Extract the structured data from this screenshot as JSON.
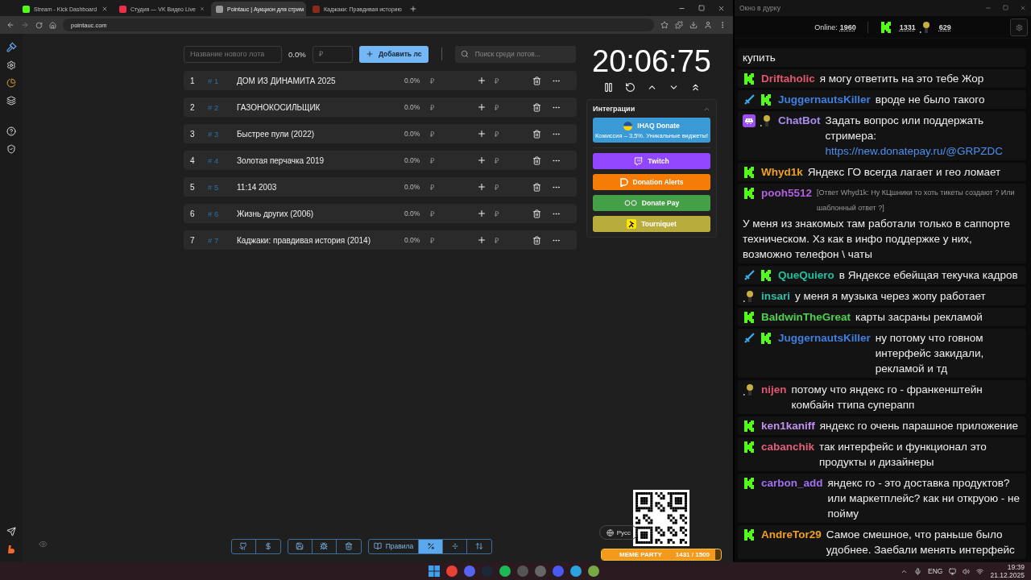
{
  "browser": {
    "tabs": [
      {
        "title": "Stream - Kick Dashboard",
        "kind": "kick",
        "selected": false
      },
      {
        "title": "Студия — VK Видео Live",
        "kind": "vk",
        "selected": false
      },
      {
        "title": "Pointauc | Аукцион для стрим",
        "kind": "pointauc",
        "selected": true
      },
      {
        "title": "Каджаки: Правдивая историю",
        "kind": "film",
        "selected": false
      }
    ],
    "address": "pointauc.com"
  },
  "auction": {
    "new_lot": {
      "name_placeholder": "Название нового лота",
      "percent": "0.0%",
      "amount_placeholder": "₽",
      "add_button": "Добавить лс"
    },
    "search": {
      "placeholder": "Поиск среди лотов..."
    },
    "lots": [
      {
        "index": "1",
        "id": "# 1",
        "name": "ДОМ ИЗ ДИНАМИТА 2025",
        "percent": "0.0%",
        "currency": "₽",
        "amount_placeholder": "₽"
      },
      {
        "index": "2",
        "id": "# 2",
        "name": "ГАЗОНОКОСИЛЬЩИК",
        "percent": "0.0%",
        "currency": "₽",
        "amount_placeholder": "₽"
      },
      {
        "index": "3",
        "id": "# 3",
        "name": "Быстрее пули (2022)",
        "percent": "0.0%",
        "currency": "₽",
        "amount_placeholder": "₽"
      },
      {
        "index": "4",
        "id": "# 4",
        "name": "Золотая перчачка 2019",
        "percent": "0.0%",
        "currency": "₽",
        "amount_placeholder": "₽"
      },
      {
        "index": "5",
        "id": "# 5",
        "name": "11:14 2003",
        "percent": "0.0%",
        "currency": "₽",
        "amount_placeholder": "₽"
      },
      {
        "index": "6",
        "id": "# 6",
        "name": "Жизнь других (2006)",
        "percent": "0.0%",
        "currency": "₽",
        "amount_placeholder": "₽"
      },
      {
        "index": "7",
        "id": "# 7",
        "name": "Каджаки: правдивая история (2014)",
        "percent": "0.0%",
        "currency": "₽",
        "amount_placeholder": "₽"
      }
    ],
    "timer": "20:06:75",
    "integrations": {
      "title": "Интеграции",
      "expanded": true,
      "services": [
        {
          "kind": "ihaq",
          "label": "IHAQ Donate",
          "subtitle": "Комиссия – 3,5%. Уникальные виджеты!"
        },
        {
          "kind": "twitch",
          "label": "Twitch"
        },
        {
          "kind": "donationalerts",
          "label": "Donation Alerts"
        },
        {
          "kind": "donatepay",
          "label": "Donate Pay"
        },
        {
          "kind": "tourniquet",
          "label": "Tourniquet"
        }
      ]
    },
    "toolbar": [
      {
        "kind": "github",
        "selected": false
      },
      {
        "kind": "dollar",
        "selected": false
      },
      {
        "kind": "save",
        "selected": false
      },
      {
        "kind": "bug",
        "selected": false
      },
      {
        "kind": "trash",
        "selected": false
      },
      {
        "kind": "rules",
        "label": "Правила",
        "selected": false
      },
      {
        "kind": "percent",
        "selected": true
      },
      {
        "kind": "divide",
        "selected": false
      },
      {
        "kind": "sort",
        "selected": false
      }
    ],
    "language": "Русс"
  },
  "overlay": {
    "party_title": "MEME PARTY",
    "party_progress": "1431 / 1500",
    "level": 0.95
  },
  "chat": {
    "window_title": "Окно в дурку",
    "online_label": "Online:",
    "online": "1960",
    "kick_count": "1331",
    "other_count": "629",
    "messages": [
      {
        "text": "купить"
      },
      {
        "badges": [
          {
            "kind": "kick"
          }
        ],
        "user": "Driftaholic",
        "color": "#e0566e",
        "text": "я могу ответить на это тебе Жор"
      },
      {
        "badges": [
          {
            "kind": "sword"
          },
          {
            "kind": "kick"
          }
        ],
        "user": "JuggernautsKiller",
        "color": "#3f7fe0",
        "text": "вроде не было такого"
      },
      {
        "badges": [
          {
            "kind": "invader"
          },
          {
            "kind": "trophy"
          }
        ],
        "user": "ChatBot",
        "color": "#a98cf0",
        "text": "Задать вопрос или поддержать стримера:",
        "link": "https://new.donatepay.ru/@GRPZDC"
      },
      {
        "badges": [
          {
            "kind": "kick"
          }
        ],
        "user": "Whyd1k",
        "color": "#f0a020",
        "text": "Яндекс ГО всегда лагает и гео ломает"
      },
      {
        "badges": [
          {
            "kind": "kick"
          }
        ],
        "user": "pooh5512",
        "color": "#b060e0",
        "reply": "[Ответ Whyd1k: Ну КЦшники то хоть тикеты создают ? Или шаблонный ответ ?]",
        "text": "У меня из знакомых там работали только в саппорте техническом. Хз как в инфо поддержке у них, возможно телефон \\ чаты"
      },
      {
        "badges": [
          {
            "kind": "sword"
          },
          {
            "kind": "kick"
          }
        ],
        "user": "QueQuiero",
        "color": "#20c0a0",
        "text": "в Яндексе ебейщая текучка кадров"
      },
      {
        "badges": [
          {
            "kind": "trophy"
          }
        ],
        "user": "insari",
        "color": "#30c0a8",
        "text": "у меня я музыка через жопу работает"
      },
      {
        "badges": [
          {
            "kind": "kick"
          }
        ],
        "user": "BaldwinTheGreat",
        "color": "#50d050",
        "text": "карты засраны рекламой"
      },
      {
        "badges": [
          {
            "kind": "sword"
          },
          {
            "kind": "kick"
          }
        ],
        "user": "JuggernautsKiller",
        "color": "#3f7fe0",
        "text": "ну потому что говном интерфейс закидали, рекламой и тд"
      },
      {
        "badges": [
          {
            "kind": "trophy"
          }
        ],
        "user": "nijen",
        "color": "#e0566e",
        "text": "потому что яндекс го - франкенштейн комбайн ттипа суперапп"
      },
      {
        "badges": [
          {
            "kind": "kick"
          }
        ],
        "user": "ken1kaniff",
        "color": "#c090f0",
        "text": "яндекс го очень парашное приложение"
      },
      {
        "badges": [
          {
            "kind": "kick"
          }
        ],
        "user": "cabanchik",
        "color": "#e0607a",
        "text": "так интерфейс и функционал это продукты и дизайнеры"
      },
      {
        "badges": [
          {
            "kind": "kick"
          }
        ],
        "user": "carbon_add",
        "color": "#a070f0",
        "text": "яндекс го - это доставка продуктов? или маркетплейс? как ни откруою - не пойму"
      },
      {
        "badges": [
          {
            "kind": "kick"
          }
        ],
        "user": "AndreTor29",
        "color": "#f0a020",
        "text": "Самое смешное, что раньше было удобнее. Заебали менять интерфейс"
      }
    ]
  },
  "taskbar": {
    "language": "ENG",
    "time": "19:39",
    "date": "21.12.2025"
  }
}
